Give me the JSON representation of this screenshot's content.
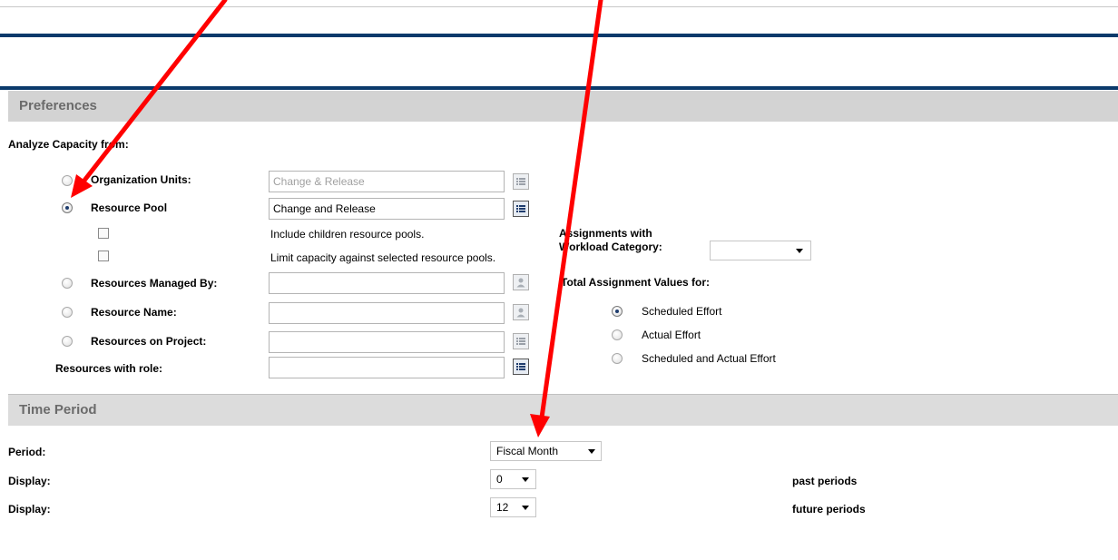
{
  "preferences": {
    "header": "Preferences",
    "analyze_label": "Analyze Capacity from:",
    "org_units": {
      "label": "Organization Units:",
      "value": "Change & Release"
    },
    "resource_pool": {
      "label": "Resource Pool",
      "value": "Change and Release"
    },
    "include_children": "Include children resource pools.",
    "limit_capacity": "Limit capacity against selected resource pools.",
    "resources_managed_by": {
      "label": "Resources Managed By:",
      "value": ""
    },
    "resource_name": {
      "label": "Resource Name:",
      "value": ""
    },
    "resources_on_project": {
      "label": "Resources on Project:",
      "value": ""
    },
    "resources_with_role": {
      "label": "Resources with role:",
      "value": ""
    },
    "assignments_label_line1": "Assignments with",
    "assignments_label_line2": "Workload Category:",
    "workload_category_value": "",
    "total_assignment_label": "Total Assignment Values for:",
    "effort_options": [
      "Scheduled Effort",
      "Actual Effort",
      "Scheduled and Actual Effort"
    ],
    "effort_selected": 0
  },
  "time_period": {
    "header": "Time Period",
    "period_label": "Period:",
    "period_value": "Fiscal Month",
    "display_label": "Display:",
    "past_value": "0",
    "past_suffix": "past periods",
    "future_value": "12",
    "future_suffix": "future periods"
  },
  "annotation_color": "#ff0000"
}
